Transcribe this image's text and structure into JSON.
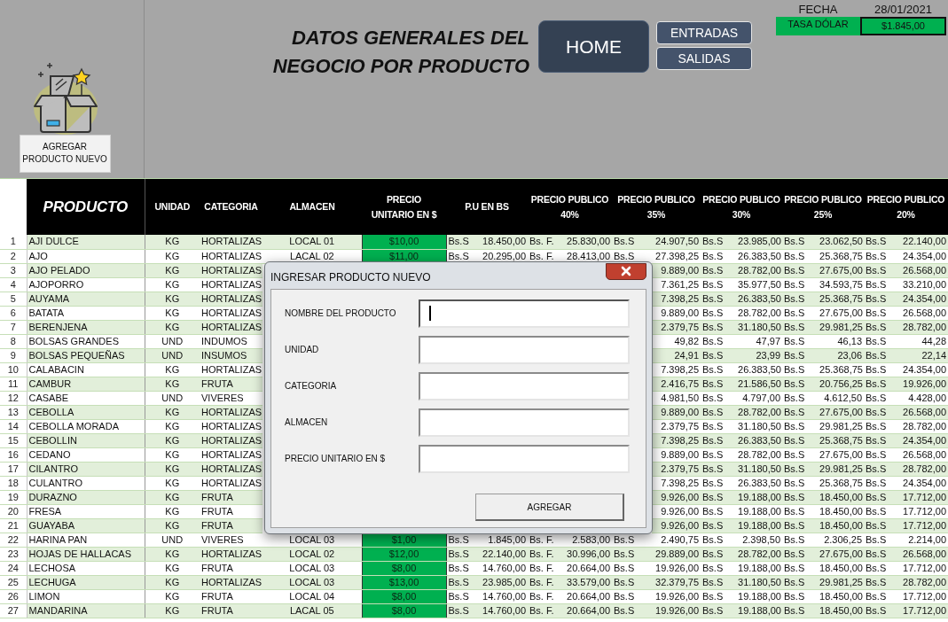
{
  "title": {
    "lines": [
      "DATOS GENERALES DEL",
      "NEGOCIO POR PRODUCTO"
    ]
  },
  "add_button": {
    "label": "AGREGAR PRODUCTO NUEVO"
  },
  "nav_buttons": [
    {
      "label": "HOME",
      "kind": "primary"
    },
    {
      "label": "ENTRADAS",
      "kind": "secondary"
    },
    {
      "label": "SALIDAS",
      "kind": "secondary"
    }
  ],
  "info": {
    "fecha_label": "FECHA",
    "fecha": "28/01/2021",
    "tasa_label": "TASA DÓLAR",
    "tasa": "$1.845,00"
  },
  "table": {
    "columns": [
      "PRODUCTO",
      "UNIDAD",
      "CATEGORIA",
      "ALMACEN",
      "PRECIO\nUNITARIO  EN $",
      "P.U EN BS",
      "PRECIO PUBLICO\n40%",
      "PRECIO PUBLICO\n35%",
      "PRECIO PUBLICO\n30%",
      "PRECIO PUBLICO\n25%",
      "PRECIO PUBLICO\n20%"
    ],
    "rows": [
      {
        "num": "1",
        "producto": "AJI DULCE",
        "unidad": "KG",
        "categoria": "HORTALIZAS",
        "almacen": "LOCAL 01",
        "precio": "$10,00",
        "pu": {
          "currency": "Bs.S",
          "value": "18.450,00"
        },
        "p40": {
          "currency": "Bs. F.",
          "value": "25.830,00"
        },
        "p35": {
          "currency": "Bs.S",
          "value": "24.907,50"
        },
        "p30": {
          "currency": "Bs.S",
          "value": "23.985,00"
        },
        "p25": {
          "currency": "Bs.S",
          "value": "23.062,50"
        },
        "p20": {
          "currency": "Bs.S",
          "value": "22.140,00"
        }
      },
      {
        "num": "2",
        "producto": "AJO",
        "unidad": "KG",
        "categoria": "HORTALIZAS",
        "almacen": "LACAL 02",
        "precio": "$11,00",
        "pu": {
          "currency": "Bs.S",
          "value": "20.295,00"
        },
        "p40": {
          "currency": "Bs. F.",
          "value": "28.413,00"
        },
        "p35": {
          "currency": "Bs.S",
          "value": "27.398,25"
        },
        "p30": {
          "currency": "Bs.S",
          "value": "26.383,50"
        },
        "p25": {
          "currency": "Bs.S",
          "value": "25.368,75"
        },
        "p20": {
          "currency": "Bs.S",
          "value": "24.354,00"
        }
      },
      {
        "num": "3",
        "producto": "AJO PELADO",
        "unidad": "KG",
        "categoria": "HORTALIZAS",
        "p35": {
          "value": "9.889,00"
        },
        "p30": {
          "currency": "Bs.S",
          "value": "28.782,00"
        },
        "p25": {
          "currency": "Bs.S",
          "value": "27.675,00"
        },
        "p20": {
          "currency": "Bs.S",
          "value": "26.568,00"
        }
      },
      {
        "num": "4",
        "producto": "AJOPORRO",
        "unidad": "KG",
        "categoria": "HORTALIZAS",
        "p35": {
          "value": "7.361,25"
        },
        "p30": {
          "currency": "Bs.S",
          "value": "35.977,50"
        },
        "p25": {
          "currency": "Bs.S",
          "value": "34.593,75"
        },
        "p20": {
          "currency": "Bs.S",
          "value": "33.210,00"
        }
      },
      {
        "num": "5",
        "producto": "AUYAMA",
        "unidad": "KG",
        "categoria": "HORTALIZAS",
        "p35": {
          "value": "7.398,25"
        },
        "p30": {
          "currency": "Bs.S",
          "value": "26.383,50"
        },
        "p25": {
          "currency": "Bs.S",
          "value": "25.368,75"
        },
        "p20": {
          "currency": "Bs.S",
          "value": "24.354,00"
        }
      },
      {
        "num": "6",
        "producto": "BATATA",
        "unidad": "KG",
        "categoria": "HORTALIZAS",
        "p35": {
          "value": "9.889,00"
        },
        "p30": {
          "currency": "Bs.S",
          "value": "28.782,00"
        },
        "p25": {
          "currency": "Bs.S",
          "value": "27.675,00"
        },
        "p20": {
          "currency": "Bs.S",
          "value": "26.568,00"
        }
      },
      {
        "num": "7",
        "producto": "BERENJENA",
        "unidad": "KG",
        "categoria": "HORTALIZAS",
        "p35": {
          "value": "2.379,75"
        },
        "p30": {
          "currency": "Bs.S",
          "value": "31.180,50"
        },
        "p25": {
          "currency": "Bs.S",
          "value": "29.981,25"
        },
        "p20": {
          "currency": "Bs.S",
          "value": "28.782,00"
        }
      },
      {
        "num": "8",
        "producto": "BOLSAS GRANDES",
        "unidad": "UND",
        "categoria": "INDUMOS",
        "p35": {
          "value": "49,82"
        },
        "p30": {
          "currency": "Bs.S",
          "value": "47,97"
        },
        "p25": {
          "currency": "Bs.S",
          "value": "46,13"
        },
        "p20": {
          "currency": "Bs.S",
          "value": "44,28"
        }
      },
      {
        "num": "9",
        "producto": "BOLSAS PEQUEÑAS",
        "unidad": "UND",
        "categoria": "INSUMOS",
        "p35": {
          "value": "24,91"
        },
        "p30": {
          "currency": "Bs.S",
          "value": "23,99"
        },
        "p25": {
          "currency": "Bs.S",
          "value": "23,06"
        },
        "p20": {
          "currency": "Bs.S",
          "value": "22,14"
        }
      },
      {
        "num": "10",
        "producto": "CALABACIN",
        "unidad": "KG",
        "categoria": "HORTALIZAS",
        "p35": {
          "value": "7.398,25"
        },
        "p30": {
          "currency": "Bs.S",
          "value": "26.383,50"
        },
        "p25": {
          "currency": "Bs.S",
          "value": "25.368,75"
        },
        "p20": {
          "currency": "Bs.S",
          "value": "24.354,00"
        }
      },
      {
        "num": "11",
        "producto": "CAMBUR",
        "unidad": "KG",
        "categoria": "FRUTA",
        "p35": {
          "value": "2.416,75"
        },
        "p30": {
          "currency": "Bs.S",
          "value": "21.586,50"
        },
        "p25": {
          "currency": "Bs.S",
          "value": "20.756,25"
        },
        "p20": {
          "currency": "Bs.S",
          "value": "19.926,00"
        }
      },
      {
        "num": "12",
        "producto": "CASABE",
        "unidad": "UND",
        "categoria": "VIVERES",
        "p35": {
          "value": "4.981,50"
        },
        "p30": {
          "currency": "Bs.S",
          "value": "4.797,00"
        },
        "p25": {
          "currency": "Bs.S",
          "value": "4.612,50"
        },
        "p20": {
          "currency": "Bs.S",
          "value": "4.428,00"
        }
      },
      {
        "num": "13",
        "producto": "CEBOLLA",
        "unidad": "KG",
        "categoria": "HORTALIZAS",
        "p35": {
          "value": "9.889,00"
        },
        "p30": {
          "currency": "Bs.S",
          "value": "28.782,00"
        },
        "p25": {
          "currency": "Bs.S",
          "value": "27.675,00"
        },
        "p20": {
          "currency": "Bs.S",
          "value": "26.568,00"
        }
      },
      {
        "num": "14",
        "producto": "CEBOLLA MORADA",
        "unidad": "KG",
        "categoria": "HORTALIZAS",
        "p35": {
          "value": "2.379,75"
        },
        "p30": {
          "currency": "Bs.S",
          "value": "31.180,50"
        },
        "p25": {
          "currency": "Bs.S",
          "value": "29.981,25"
        },
        "p20": {
          "currency": "Bs.S",
          "value": "28.782,00"
        }
      },
      {
        "num": "15",
        "producto": "CEBOLLIN",
        "unidad": "KG",
        "categoria": "HORTALIZAS",
        "p35": {
          "value": "7.398,25"
        },
        "p30": {
          "currency": "Bs.S",
          "value": "26.383,50"
        },
        "p25": {
          "currency": "Bs.S",
          "value": "25.368,75"
        },
        "p20": {
          "currency": "Bs.S",
          "value": "24.354,00"
        }
      },
      {
        "num": "16",
        "producto": "CEDANO",
        "unidad": "KG",
        "categoria": "HORTALIZAS",
        "p35": {
          "value": "9.889,00"
        },
        "p30": {
          "currency": "Bs.S",
          "value": "28.782,00"
        },
        "p25": {
          "currency": "Bs.S",
          "value": "27.675,00"
        },
        "p20": {
          "currency": "Bs.S",
          "value": "26.568,00"
        }
      },
      {
        "num": "17",
        "producto": "CILANTRO",
        "unidad": "KG",
        "categoria": "HORTALIZAS",
        "p35": {
          "value": "2.379,75"
        },
        "p30": {
          "currency": "Bs.S",
          "value": "31.180,50"
        },
        "p25": {
          "currency": "Bs.S",
          "value": "29.981,25"
        },
        "p20": {
          "currency": "Bs.S",
          "value": "28.782,00"
        }
      },
      {
        "num": "18",
        "producto": "CULANTRO",
        "unidad": "KG",
        "categoria": "HORTALIZAS",
        "p35": {
          "value": "7.398,25"
        },
        "p30": {
          "currency": "Bs.S",
          "value": "26.383,50"
        },
        "p25": {
          "currency": "Bs.S",
          "value": "25.368,75"
        },
        "p20": {
          "currency": "Bs.S",
          "value": "24.354,00"
        }
      },
      {
        "num": "19",
        "producto": "DURAZNO",
        "unidad": "KG",
        "categoria": "FRUTA",
        "p35": {
          "value": "9.926,00"
        },
        "p30": {
          "currency": "Bs.S",
          "value": "19.188,00"
        },
        "p25": {
          "currency": "Bs.S",
          "value": "18.450,00"
        },
        "p20": {
          "currency": "Bs.S",
          "value": "17.712,00"
        }
      },
      {
        "num": "20",
        "producto": "FRESA",
        "unidad": "KG",
        "categoria": "FRUTA",
        "p35": {
          "value": "9.926,00"
        },
        "p30": {
          "currency": "Bs.S",
          "value": "19.188,00"
        },
        "p25": {
          "currency": "Bs.S",
          "value": "18.450,00"
        },
        "p20": {
          "currency": "Bs.S",
          "value": "17.712,00"
        }
      },
      {
        "num": "21",
        "producto": "GUAYABA",
        "unidad": "KG",
        "categoria": "FRUTA",
        "p35": {
          "value": "9.926,00"
        },
        "p30": {
          "currency": "Bs.S",
          "value": "19.188,00"
        },
        "p25": {
          "currency": "Bs.S",
          "value": "18.450,00"
        },
        "p20": {
          "currency": "Bs.S",
          "value": "17.712,00"
        }
      },
      {
        "num": "22",
        "producto": "HARINA PAN",
        "unidad": "UND",
        "categoria": "VIVERES",
        "almacen": "LOCAL 03",
        "precio": "$1,00",
        "pu": {
          "currency": "Bs.S",
          "value": "1.845,00"
        },
        "p40": {
          "currency": "Bs. F.",
          "value": "2.583,00"
        },
        "p35": {
          "currency": "Bs.S",
          "value": "2.490,75"
        },
        "p30": {
          "currency": "Bs.S",
          "value": "2.398,50"
        },
        "p25": {
          "currency": "Bs.S",
          "value": "2.306,25"
        },
        "p20": {
          "currency": "Bs.S",
          "value": "2.214,00"
        }
      },
      {
        "num": "23",
        "producto": "HOJAS DE HALLACAS",
        "unidad": "KG",
        "categoria": "HORTALIZAS",
        "almacen": "LOCAL 02",
        "precio": "$12,00",
        "pu": {
          "currency": "Bs.S",
          "value": "22.140,00"
        },
        "p40": {
          "currency": "Bs. F.",
          "value": "30.996,00"
        },
        "p35": {
          "currency": "Bs.S",
          "value": "29.889,00"
        },
        "p30": {
          "currency": "Bs.S",
          "value": "28.782,00"
        },
        "p25": {
          "currency": "Bs.S",
          "value": "27.675,00"
        },
        "p20": {
          "currency": "Bs.S",
          "value": "26.568,00"
        }
      },
      {
        "num": "24",
        "producto": "LECHOSA",
        "unidad": "KG",
        "categoria": "FRUTA",
        "almacen": "LOCAL 03",
        "precio": "$8,00",
        "pu": {
          "currency": "Bs.S",
          "value": "14.760,00"
        },
        "p40": {
          "currency": "Bs. F.",
          "value": "20.664,00"
        },
        "p35": {
          "currency": "Bs.S",
          "value": "19.926,00"
        },
        "p30": {
          "currency": "Bs.S",
          "value": "19.188,00"
        },
        "p25": {
          "currency": "Bs.S",
          "value": "18.450,00"
        },
        "p20": {
          "currency": "Bs.S",
          "value": "17.712,00"
        }
      },
      {
        "num": "25",
        "producto": "LECHUGA",
        "unidad": "KG",
        "categoria": "HORTALIZAS",
        "almacen": "LOCAL 03",
        "precio": "$13,00",
        "pu": {
          "currency": "Bs.S",
          "value": "23.985,00"
        },
        "p40": {
          "currency": "Bs. F.",
          "value": "33.579,00"
        },
        "p35": {
          "currency": "Bs.S",
          "value": "32.379,75"
        },
        "p30": {
          "currency": "Bs.S",
          "value": "31.180,50"
        },
        "p25": {
          "currency": "Bs.S",
          "value": "29.981,25"
        },
        "p20": {
          "currency": "Bs.S",
          "value": "28.782,00"
        }
      },
      {
        "num": "26",
        "producto": "LIMON",
        "unidad": "KG",
        "categoria": "FRUTA",
        "almacen": "LOCAL 04",
        "precio": "$8,00",
        "pu": {
          "currency": "Bs.S",
          "value": "14.760,00"
        },
        "p40": {
          "currency": "Bs. F.",
          "value": "20.664,00"
        },
        "p35": {
          "currency": "Bs.S",
          "value": "19.926,00"
        },
        "p30": {
          "currency": "Bs.S",
          "value": "19.188,00"
        },
        "p25": {
          "currency": "Bs.S",
          "value": "18.450,00"
        },
        "p20": {
          "currency": "Bs.S",
          "value": "17.712,00"
        }
      },
      {
        "num": "27",
        "producto": "MANDARINA",
        "unidad": "KG",
        "categoria": "FRUTA",
        "almacen": "LACAL 05",
        "precio": "$8,00",
        "pu": {
          "currency": "Bs.S",
          "value": "14.760,00"
        },
        "p40": {
          "currency": "Bs. F.",
          "value": "20.664,00"
        },
        "p35": {
          "currency": "Bs.S",
          "value": "19.926,00"
        },
        "p30": {
          "currency": "Bs.S",
          "value": "19.188,00"
        },
        "p25": {
          "currency": "Bs.S",
          "value": "18.450,00"
        },
        "p20": {
          "currency": "Bs.S",
          "value": "17.712,00"
        }
      }
    ]
  },
  "dialog": {
    "title": "INGRESAR PRODUCTO NUEVO",
    "fields": [
      {
        "label": "NOMBRE DEL PRODUCTO",
        "focused": true
      },
      {
        "label": "UNIDAD",
        "focused": false
      },
      {
        "label": "CATEGORIA",
        "focused": false
      },
      {
        "label": "ALMACEN",
        "focused": false
      },
      {
        "label": "PRECIO UNITARIO EN $",
        "focused": false
      }
    ],
    "submit": "AGREGAR"
  }
}
